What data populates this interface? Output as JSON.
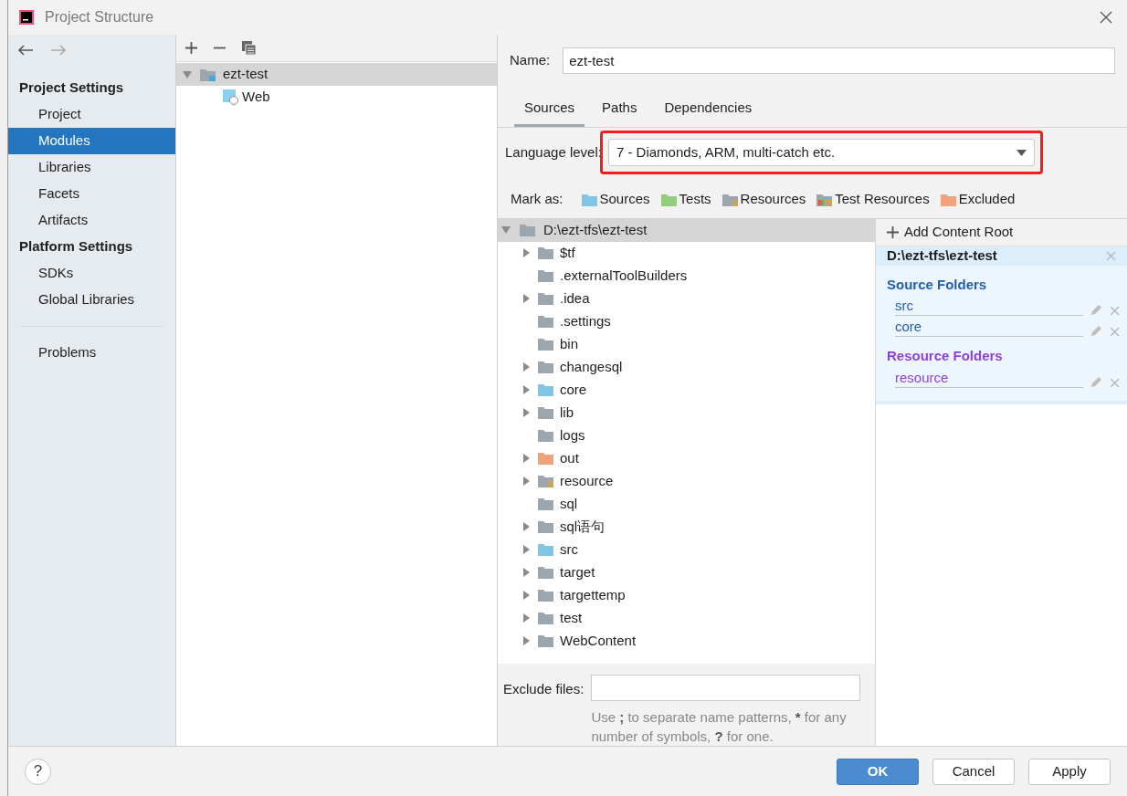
{
  "window": {
    "title": "Project Structure"
  },
  "sidebar": {
    "sections": [
      {
        "title": "Project Settings",
        "items": [
          {
            "label": "Project",
            "selected": false
          },
          {
            "label": "Modules",
            "selected": true
          },
          {
            "label": "Libraries",
            "selected": false
          },
          {
            "label": "Facets",
            "selected": false
          },
          {
            "label": "Artifacts",
            "selected": false
          }
        ]
      },
      {
        "title": "Platform Settings",
        "items": [
          {
            "label": "SDKs",
            "selected": false
          },
          {
            "label": "Global Libraries",
            "selected": false
          }
        ]
      }
    ],
    "problems": {
      "label": "Problems",
      "selected": false
    }
  },
  "modules": [
    {
      "label": "ezt-test",
      "selected": true,
      "expanded": true,
      "children": [
        {
          "label": "Web",
          "selected": false
        }
      ]
    }
  ],
  "name_field": {
    "label": "Name:",
    "value": "ezt-test"
  },
  "tabs": [
    {
      "label": "Sources",
      "selected": true
    },
    {
      "label": "Paths",
      "selected": false
    },
    {
      "label": "Dependencies",
      "selected": false
    }
  ],
  "language_level": {
    "label": "Language level:",
    "value": "7 - Diamonds, ARM, multi-catch etc.",
    "highlighted": true
  },
  "mark_as": {
    "label": "Mark as:",
    "options": [
      {
        "label": "Sources",
        "kind": "source"
      },
      {
        "label": "Tests",
        "kind": "test"
      },
      {
        "label": "Resources",
        "kind": "resource"
      },
      {
        "label": "Test Resources",
        "kind": "test_resource"
      },
      {
        "label": "Excluded",
        "kind": "excluded"
      }
    ]
  },
  "folder_tree": {
    "root": {
      "label": "D:\\ezt-tfs\\ezt-test",
      "selected": true,
      "expanded": true
    },
    "children": [
      {
        "label": "$tf",
        "kind": "plain",
        "expandable": true
      },
      {
        "label": ".externalToolBuilders",
        "kind": "plain",
        "expandable": false
      },
      {
        "label": ".idea",
        "kind": "plain",
        "expandable": true
      },
      {
        "label": ".settings",
        "kind": "plain",
        "expandable": false
      },
      {
        "label": "bin",
        "kind": "plain",
        "expandable": false
      },
      {
        "label": "changesql",
        "kind": "plain",
        "expandable": true
      },
      {
        "label": "core",
        "kind": "source",
        "expandable": true
      },
      {
        "label": "lib",
        "kind": "plain",
        "expandable": true
      },
      {
        "label": "logs",
        "kind": "plain",
        "expandable": false
      },
      {
        "label": "out",
        "kind": "excluded",
        "expandable": true
      },
      {
        "label": "resource",
        "kind": "resource",
        "expandable": true
      },
      {
        "label": "sql",
        "kind": "plain",
        "expandable": false
      },
      {
        "label": "sql语句",
        "kind": "plain",
        "expandable": true
      },
      {
        "label": "src",
        "kind": "source",
        "expandable": true
      },
      {
        "label": "target",
        "kind": "plain",
        "expandable": true
      },
      {
        "label": "targettemp",
        "kind": "plain",
        "expandable": true
      },
      {
        "label": "test",
        "kind": "plain",
        "expandable": true
      },
      {
        "label": "WebContent",
        "kind": "plain",
        "expandable": true
      }
    ]
  },
  "exclude_files": {
    "label": "Exclude files:",
    "help": [
      {
        "text": "Use ",
        "bold": false
      },
      {
        "text": ";",
        "bold": true
      },
      {
        "text": " to separate name patterns, ",
        "bold": false
      },
      {
        "text": "*",
        "bold": true
      },
      {
        "text": " for any number of symbols, ",
        "bold": false
      },
      {
        "text": "?",
        "bold": true
      },
      {
        "text": " for one.",
        "bold": false
      }
    ]
  },
  "content_root": {
    "add_label": "Add Content Root",
    "path": "D:\\ezt-tfs\\ezt-test",
    "groups": [
      {
        "title": "Source Folders",
        "kind": "source",
        "folders": [
          "src",
          "core"
        ]
      },
      {
        "title": "Resource Folders",
        "kind": "resource",
        "folders": [
          "resource"
        ]
      }
    ]
  },
  "help_button": "?",
  "buttons": [
    {
      "label": "OK",
      "primary": true
    },
    {
      "label": "Cancel",
      "primary": false
    },
    {
      "label": "Apply",
      "primary": false
    }
  ]
}
